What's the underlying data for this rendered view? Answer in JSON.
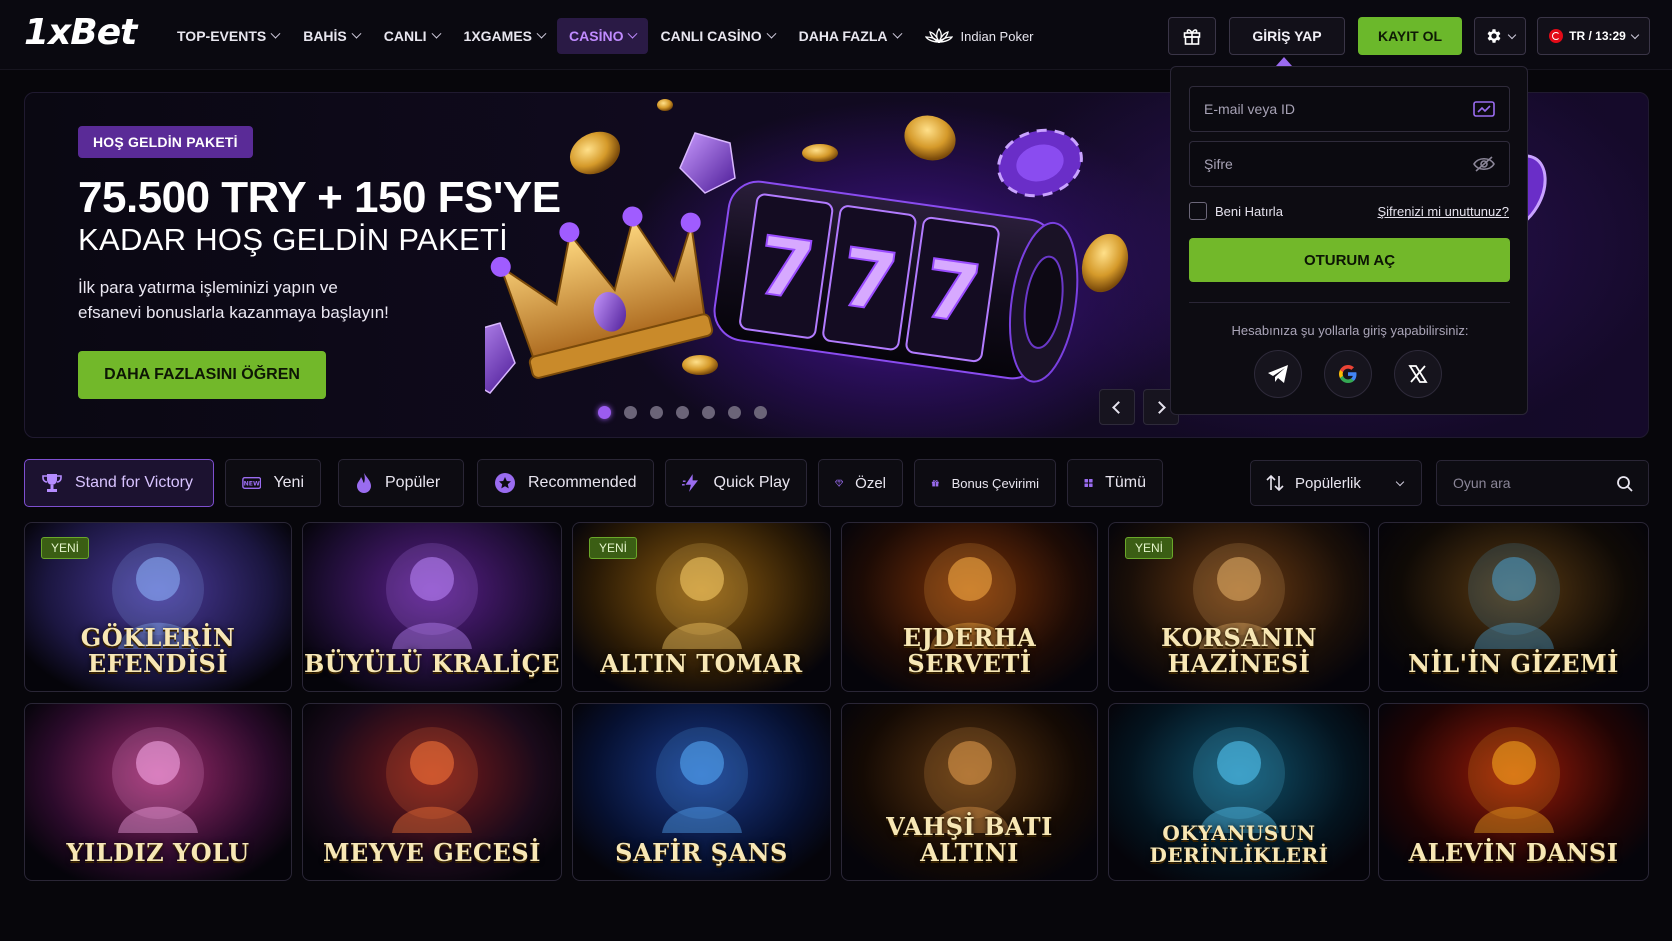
{
  "header": {
    "logo": "1xBet",
    "nav": [
      {
        "label": "TOP-EVENTS"
      },
      {
        "label": "BAHİS"
      },
      {
        "label": "CANLI"
      },
      {
        "label": "1XGAMES"
      },
      {
        "label": "CASİNO",
        "active": true
      },
      {
        "label": "CANLI CASİNO"
      },
      {
        "label": "DAHA FAZLA"
      }
    ],
    "poker_label": "Indian Poker",
    "login_label": "GİRİŞ YAP",
    "register_label": "KAYIT OL",
    "lang_time": "TR / 13:29"
  },
  "banner": {
    "badge": "HOŞ GELDİN PAKETİ",
    "title": "75.500 TRY + 150 FS'YE",
    "subtitle": "KADAR HOŞ GELDİN PAKETİ",
    "description_line1": "İlk para yatırma işleminizi yapın ve",
    "description_line2": "efsanevi bonuslarla kazanmaya başlayın!",
    "cta": "DAHA FAZLASINI ÖĞREN",
    "slides_total": 7,
    "slide_active": 1,
    "reel_text": "777"
  },
  "login_panel": {
    "email_placeholder": "E-mail veya ID",
    "password_placeholder": "Şifre",
    "remember_label": "Beni Hatırla",
    "forgot_label": "Şifrenizi mi unuttunuz?",
    "submit_label": "OTURUM AÇ",
    "social_title": "Hesabınıza şu yollarla giriş yapabilirsiniz:",
    "social": [
      "telegram-icon",
      "google-icon",
      "x-icon"
    ]
  },
  "filters": {
    "chips": [
      {
        "label": "Stand for Victory",
        "icon": "trophy-icon",
        "active": true
      },
      {
        "label": "Yeni",
        "icon": "new-icon"
      },
      {
        "label": "Popüler",
        "icon": "flame-icon"
      },
      {
        "label": "Recommended",
        "icon": "star-icon"
      },
      {
        "label": "Quick Play",
        "icon": "lightning-icon"
      },
      {
        "label": "Özel",
        "icon": "diamond-icon"
      },
      {
        "label": "Bonus Çevirimi",
        "icon": "gift-icon"
      },
      {
        "label": "Tümü",
        "icon": "grid-icon"
      }
    ],
    "sort_label": "Popülerlik",
    "search_placeholder": "Oyun ara"
  },
  "games": [
    {
      "title": "GÖKLERİN EFENDİSİ",
      "badge": "YENİ"
    },
    {
      "title": "BÜYÜLÜ KRALİÇE",
      "badge": ""
    },
    {
      "title": "ALTIN TOMAR",
      "badge": "YENİ"
    },
    {
      "title": "EJDERHA SERVETİ",
      "badge": ""
    },
    {
      "title": "KORSANIN HAZİNESİ",
      "badge": "YENİ"
    },
    {
      "title": "NİL'İN GİZEMİ",
      "badge": ""
    },
    {
      "title": "YILDIZ YOLU",
      "badge": ""
    },
    {
      "title": "MEYVE GECESİ",
      "badge": ""
    },
    {
      "title": "SAFİR ŞANS",
      "badge": ""
    },
    {
      "title": "VAHŞİ BATI ALTINI",
      "badge": ""
    },
    {
      "title": "OKYANUSUN DERİNLİKLERİ",
      "badge": ""
    },
    {
      "title": "ALEVİN DANSI",
      "badge": ""
    }
  ],
  "colors": {
    "accent_green": "#72b82a",
    "accent_purple": "#9b5cf0",
    "background": "#07060b"
  }
}
